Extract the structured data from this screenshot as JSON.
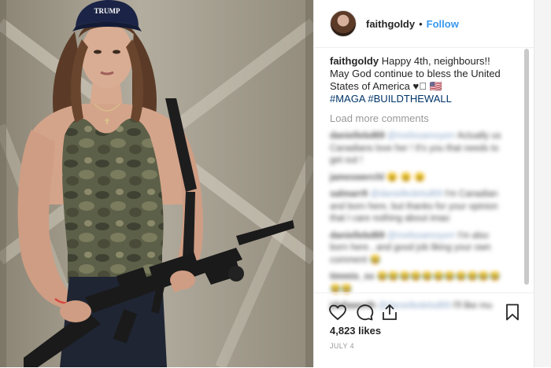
{
  "post": {
    "username": "faithgoldy",
    "separator": "•",
    "follow_label": "Follow",
    "hat_text": "TRUMP",
    "caption": {
      "username": "faithgoldy",
      "text": "Happy 4th, neighbours!! May God continue to bless the United States of America ♥🏻 🇺🇸",
      "hashtags": "#MAGA #BUILDTHEWALL"
    },
    "load_more_label": "Load more comments",
    "likes": "4,823 likes",
    "date": "JULY 4"
  },
  "blurred_comments": [
    {
      "user": "daniellebd69",
      "mention": "@melissamoyerr",
      "text": "Actually us Canadians love her ! It's you that needs to get out !"
    },
    {
      "user": "jameswerchl",
      "mention": "",
      "text": "😮 😮 😮"
    },
    {
      "user": "salmarr9",
      "mention": "@danielledelsd69",
      "text": "I'm Canadian and born here, but thanks for your opinion that I care nothing about imao"
    },
    {
      "user": "daniellebd69",
      "mention": "@melissamoyerr",
      "text": "I'm also born here , and good job liking your own comment 😂"
    },
    {
      "user": "timmis_ss",
      "mention": "",
      "text": "😂😂😂😂😂😂😂😂😂😂😂😂😂"
    },
    {
      "user": "jdafaworth",
      "mention": "@danielledelsd69",
      "text": "I'll like mu"
    }
  ],
  "icons": [
    "heart-icon",
    "comment-icon",
    "share-icon",
    "bookmark-icon"
  ],
  "colors": {
    "link": "#3897f0",
    "hashtag": "#003569",
    "muted": "#999999",
    "text": "#262626"
  }
}
